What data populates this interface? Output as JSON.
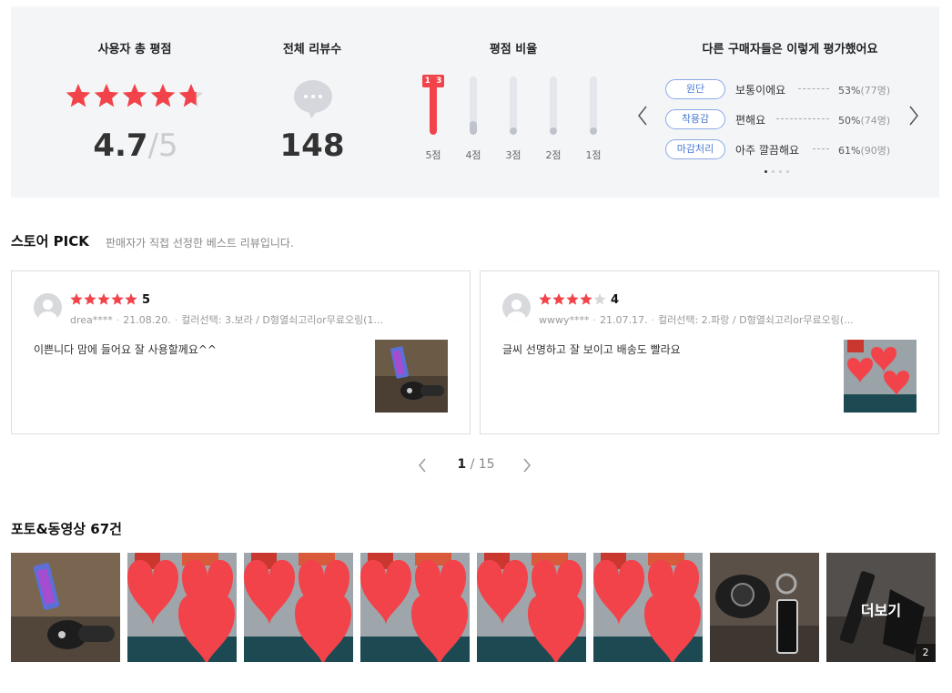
{
  "summary": {
    "total_rating_title": "사용자 총 평점",
    "rating_value": "4.7",
    "rating_max": "5",
    "review_count_title": "전체 리뷰수",
    "review_count": "148",
    "distribution_title": "평점 비율",
    "distribution_top_count": "113",
    "distribution": [
      {
        "label": "5점",
        "fraction": 0.76
      },
      {
        "label": "4점",
        "fraction": 0.18
      },
      {
        "label": "3점",
        "fraction": 0.03
      },
      {
        "label": "2점",
        "fraction": 0.01
      },
      {
        "label": "1점",
        "fraction": 0.01
      }
    ],
    "others_title": "다른 구매자들은 이렇게 평가했어요",
    "attributes": [
      {
        "tag": "원단",
        "value": "보통이에요",
        "percent": "53%",
        "count": "(77명)"
      },
      {
        "tag": "착용감",
        "value": "편해요",
        "percent": "50%",
        "count": "(74명)"
      },
      {
        "tag": "마감처리",
        "value": "아주 깔끔해요",
        "percent": "61%",
        "count": "(90명)"
      }
    ],
    "carousel_page": 1,
    "carousel_pages": 4
  },
  "pick": {
    "title": "스토어 PICK",
    "subtitle": "판매자가 직접 선정한 베스트 리뷰입니다.",
    "reviews": [
      {
        "stars": 5,
        "score": "5",
        "user": "drea****",
        "date": "21.08.20.",
        "option": "컬러선택: 3.보라 / D형열쇠고리or무료오링(1...",
        "text": "이쁜니다 맘에 들어요 잘 사용할께요^^"
      },
      {
        "stars": 4,
        "score": "4",
        "user": "wwwy****",
        "date": "21.07.17.",
        "option": "컬러선택: 2.파랑 / D형열쇠고리or무료오링(...",
        "text": "글씨 선명하고 잘 보이고 배송도 빨라요"
      }
    ],
    "page_current": "1",
    "page_total": "15"
  },
  "photos": {
    "title": "포토&동영상 67건",
    "more_label": "더보기",
    "more_count": "2"
  },
  "colors": {
    "accent_red": "#f2434a",
    "tag_blue": "#4c7ad4",
    "panel_bg": "#f4f5f7"
  }
}
